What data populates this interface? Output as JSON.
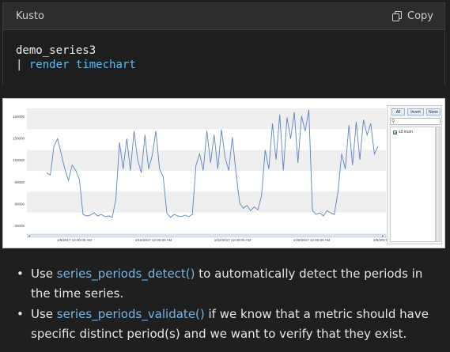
{
  "code_block": {
    "language": "Kusto",
    "copy_label": "Copy",
    "line1": "demo_series3",
    "line2_pipe": "|",
    "line2_kw": "render",
    "line2_fn": "timechart"
  },
  "chart_data": {
    "type": "line",
    "y_ticks": [
      "160000",
      "150000",
      "120000",
      "90000",
      "60000",
      "30000"
    ],
    "x_ticks": [
      "1/8/2017 12:00:00 AM",
      "1/15/2017 12:00:00 AM",
      "1/22/2017 12:00:00 AM",
      "1/29/2017 12:00:00 AM",
      "2/5/2017 12:00:00 AM"
    ],
    "ylim": [
      15000,
      180000
    ],
    "grid": true,
    "legend_position": "right",
    "series_name": "s3 mum",
    "color": "#5b84c4",
    "values": [
      95000,
      92000,
      130000,
      140000,
      120000,
      100000,
      85000,
      105000,
      98000,
      86000,
      40000,
      38000,
      39000,
      42000,
      38000,
      40000,
      37000,
      38000,
      36000,
      60000,
      135000,
      100000,
      140000,
      98000,
      150000,
      112000,
      95000,
      145000,
      100000,
      118000,
      150000,
      100000,
      90000,
      42000,
      36000,
      40000,
      38000,
      37000,
      39000,
      37000,
      40000,
      105000,
      120000,
      98000,
      150000,
      108000,
      145000,
      100000,
      152000,
      115000,
      98000,
      142000,
      95000,
      55000,
      48000,
      52000,
      45000,
      50000,
      46000,
      65000,
      125000,
      100000,
      160000,
      112000,
      172000,
      98000,
      168000,
      140000,
      175000,
      108000,
      170000,
      150000,
      178000,
      45000,
      40000,
      42000,
      38000,
      45000,
      42000,
      40000,
      70000,
      120000,
      100000,
      158000,
      105000,
      162000,
      112000,
      165000,
      145000,
      160000,
      120000,
      130000
    ],
    "overview": true
  },
  "legend_panel": {
    "buttons": [
      "All",
      "Invert",
      "None"
    ]
  },
  "bullets": [
    {
      "prefix": "Use ",
      "link": "series_periods_detect()",
      "suffix": " to automatically detect the periods in the time series."
    },
    {
      "prefix": "Use ",
      "link": "series_periods_validate()",
      "suffix": " if we know that a metric should have specific distinct period(s) and we want to verify that they exist."
    }
  ]
}
